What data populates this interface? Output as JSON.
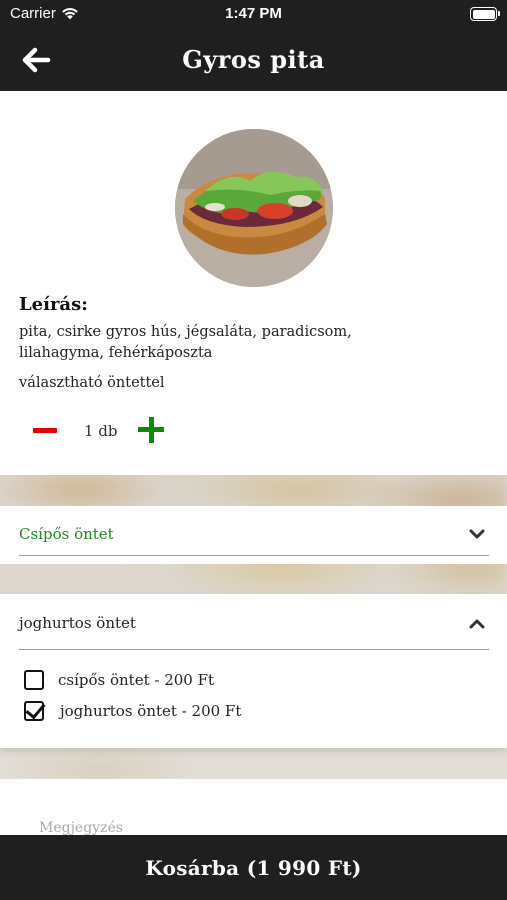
{
  "status_bar": {
    "carrier": "Carrier",
    "time": "1:47 PM",
    "battery_level": 1.0
  },
  "nav": {
    "title": "Gyros pita",
    "back_icon": "arrow-left-icon"
  },
  "product": {
    "image_name": "gyros-pita-photo",
    "description_heading": "Leírás:",
    "description": "pita, csirke gyros hús, jégsaláta, paradicsom, lilahagyma, fehérkáposzta",
    "note": "választható öntettel",
    "quantity_label": "1 db",
    "quantity": 1
  },
  "sauce_sections": [
    {
      "title": "Csípős öntet",
      "expanded": false,
      "chevron_icon": "chevron-down-icon",
      "title_color": "#1c8d1c"
    },
    {
      "title": "joghurtos öntet",
      "expanded": true,
      "chevron_icon": "chevron-up-icon",
      "options": [
        {
          "label": "csípős öntet - 200 Ft",
          "checked": false
        },
        {
          "label": "joghurtos öntet - 200 Ft",
          "checked": true
        }
      ]
    }
  ],
  "notes": {
    "placeholder": "Megjegyzés"
  },
  "cart_button": {
    "label": "Kosárba (1 990 Ft)"
  },
  "colors": {
    "bar_background": "#1f1f1f",
    "minus": "#e00000",
    "plus": "#0b8a0b"
  }
}
